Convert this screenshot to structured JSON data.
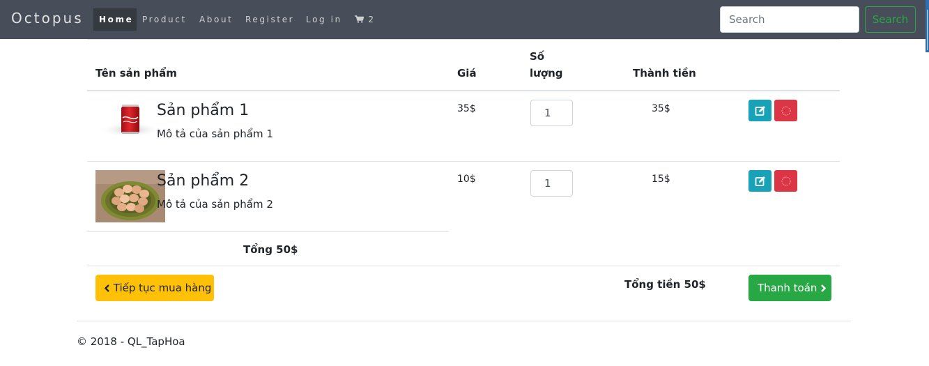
{
  "navbar": {
    "brand": "Octopus",
    "items": [
      {
        "label": "Home"
      },
      {
        "label": "Product"
      },
      {
        "label": "About"
      },
      {
        "label": "Register"
      },
      {
        "label": "Log in"
      }
    ],
    "cart_count": "2",
    "search_placeholder": "Search",
    "search_button": "Search"
  },
  "table": {
    "headers": {
      "name": "Tên sản phẩm",
      "price": "Giá",
      "qty_line1": "Số",
      "qty_line2": "lượng",
      "subtotal": "Thành tiền"
    },
    "rows": [
      {
        "name": "Sản phẩm 1",
        "desc": "Mô tả của sản phẩm 1",
        "price": "35$",
        "qty": "1",
        "subtotal": "35$",
        "image": "coca-cola-can"
      },
      {
        "name": "Sản phẩm 2",
        "desc": "Mô tả của sản phẩm 2",
        "price": "10$",
        "qty": "1",
        "subtotal": "15$",
        "image": "eggs-basket"
      }
    ],
    "total_label": "Tổng 50$"
  },
  "footer_bar": {
    "continue_label": "Tiếp tục mua hàng",
    "grand_total": "Tổng tiền 50$",
    "checkout_label": "Thanh toán"
  },
  "footer": {
    "copyright": "© 2018 - QL_TapHoa"
  },
  "colors": {
    "navbar": "#474e59",
    "edit": "#17a2b8",
    "delete": "#dc3545",
    "continue": "#ffc107",
    "checkout": "#28a745"
  }
}
